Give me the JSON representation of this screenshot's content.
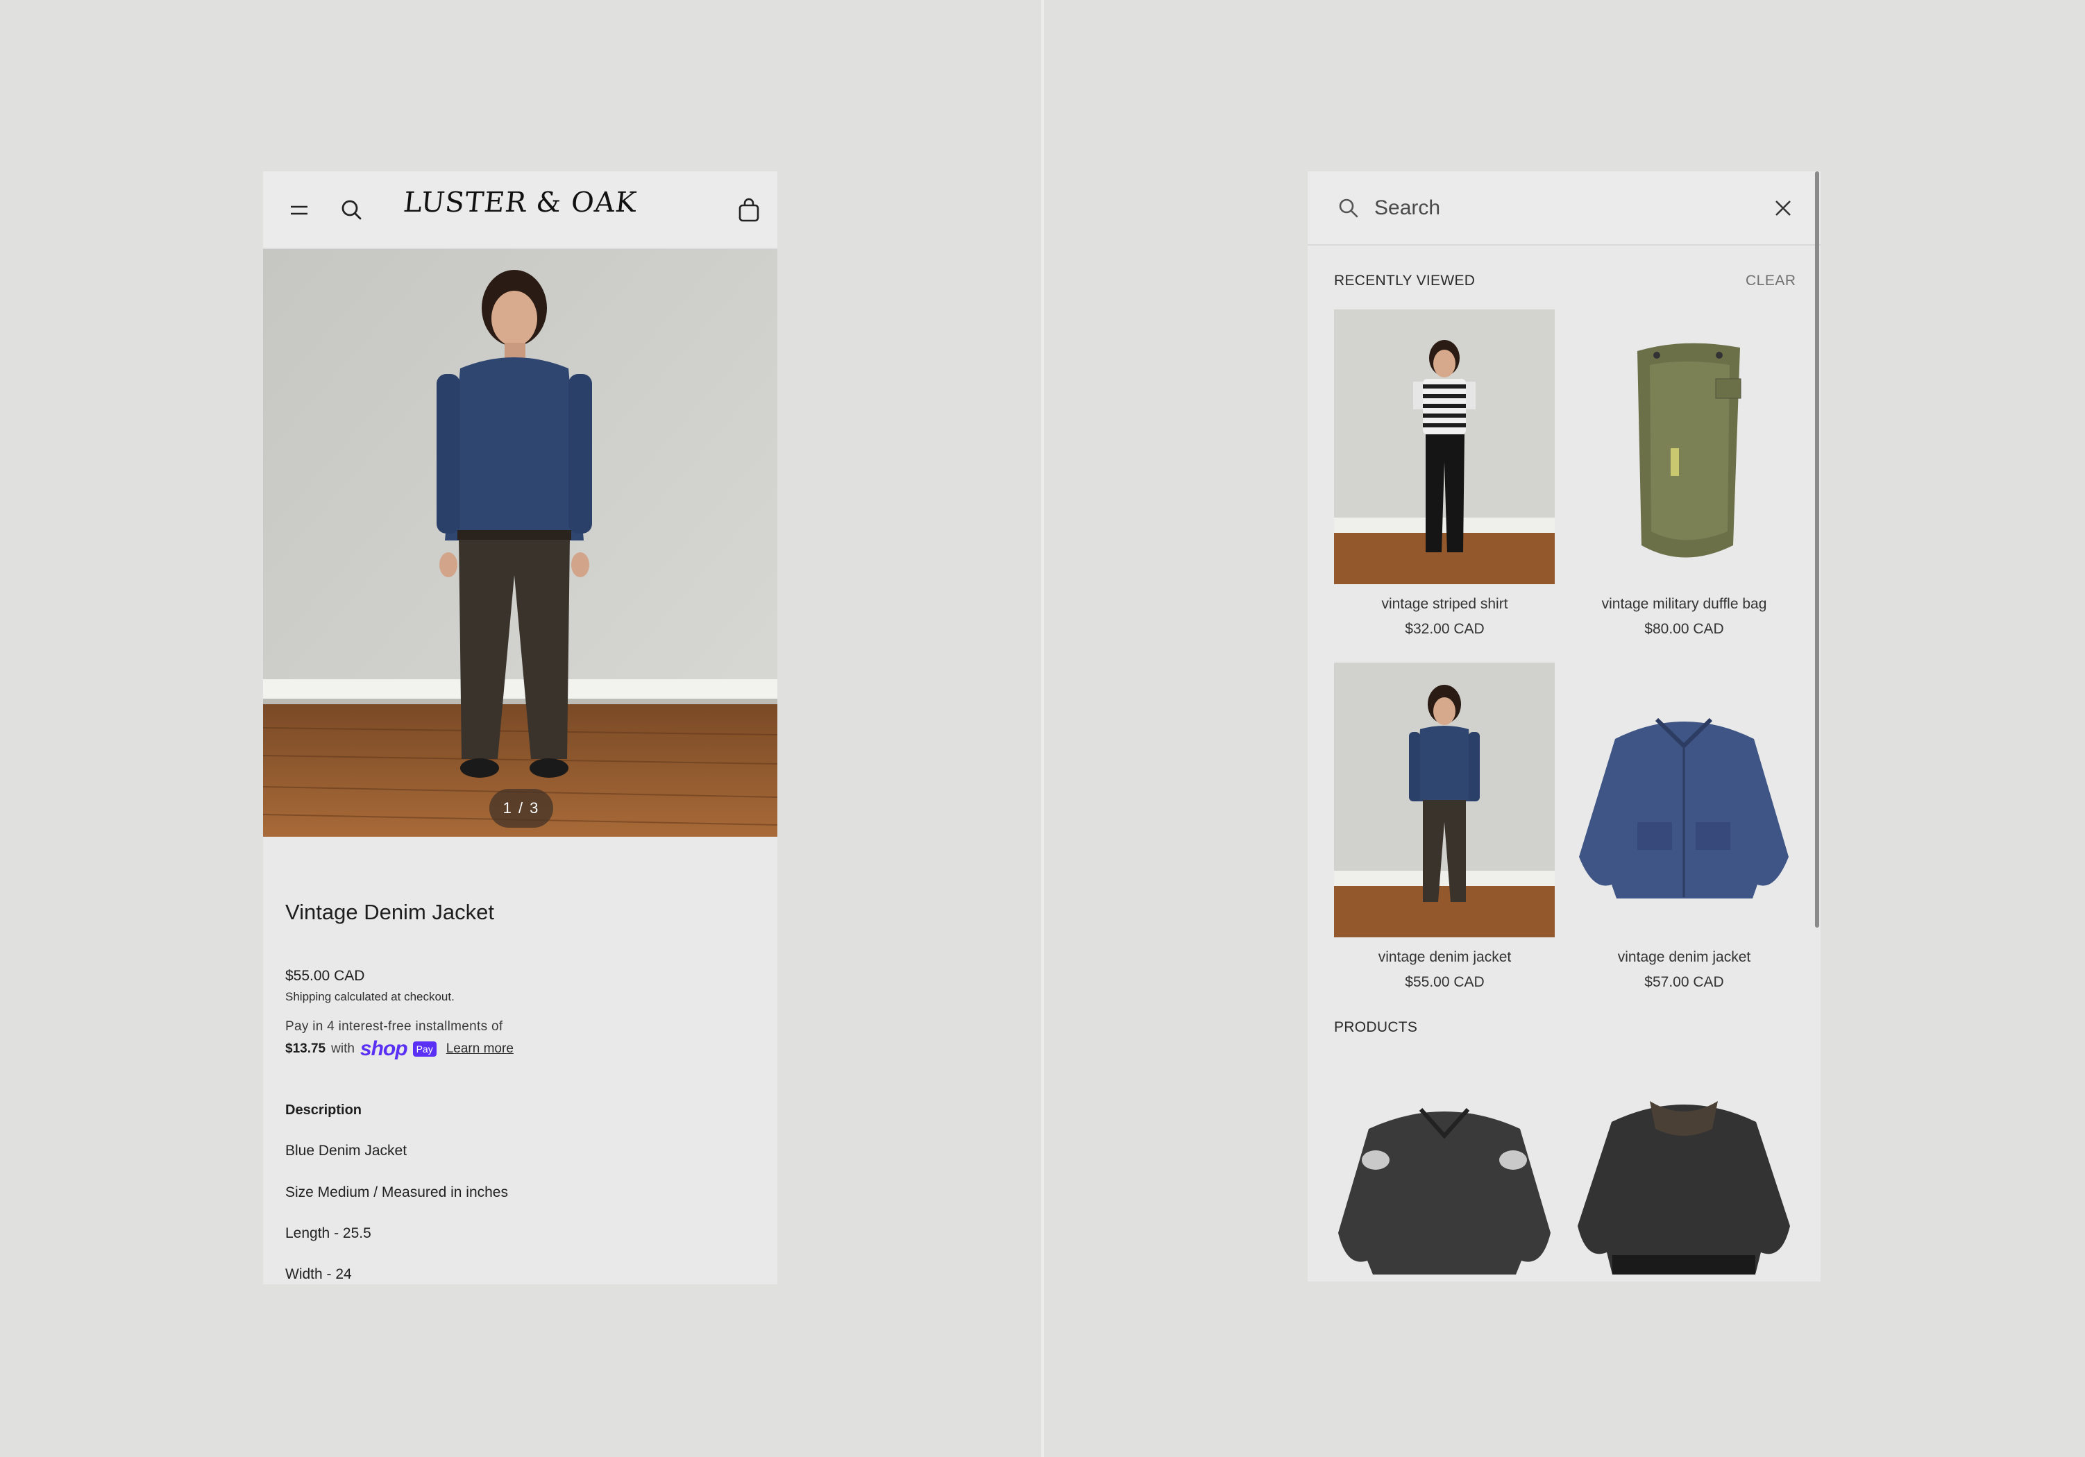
{
  "product_page": {
    "brand": "LUSTER & OAK",
    "image_counter": "1 / 3",
    "title": "Vintage Denim Jacket",
    "price": "$55.00 CAD",
    "shipping_note": "Shipping calculated at checkout.",
    "installments_line1": "Pay in 4 interest-free installments of",
    "installment_amount": "$13.75",
    "installment_with": "with",
    "shop_logo": "shop",
    "pay_badge": "Pay",
    "learn_more": "Learn more",
    "description_heading": "Description",
    "description_lines": [
      "Blue Denim Jacket",
      "Size Medium / Measured in inches",
      "Length - 25.5",
      "Width - 24"
    ]
  },
  "search_panel": {
    "placeholder": "Search",
    "recently_viewed_label": "RECENTLY VIEWED",
    "clear_label": "CLEAR",
    "recent_items": [
      {
        "name": "vintage striped shirt",
        "price": "$32.00 CAD"
      },
      {
        "name": "vintage military duffle bag",
        "price": "$80.00 CAD"
      },
      {
        "name": "vintage denim jacket",
        "price": "$55.00 CAD"
      },
      {
        "name": "vintage denim jacket",
        "price": "$57.00 CAD"
      }
    ],
    "products_label": "PRODUCTS"
  },
  "icons": {
    "menu": "menu-icon",
    "search": "search-icon",
    "cart": "cart-icon",
    "close": "close-icon"
  },
  "colors": {
    "shop_pay_purple": "#5a31f4",
    "page_background": "#e0e0de",
    "panel_background": "#e9e9e9"
  }
}
